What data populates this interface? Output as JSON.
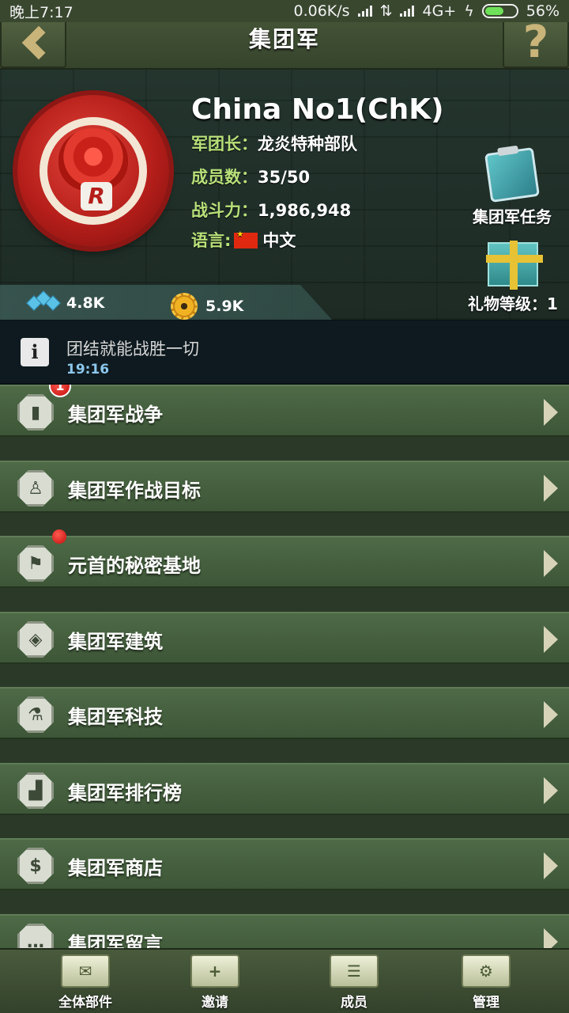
{
  "status_bar": {
    "time": "晚上7:17",
    "network_speed": "0.06K/s",
    "network_type": "4G+",
    "battery": "56%"
  },
  "title_bar": {
    "title": "集团军",
    "help_glyph": "?"
  },
  "legion": {
    "name": "China  No1(ChK)",
    "emblem_letter": "R",
    "leader_label": "军团长：",
    "leader_value": "龙炎特种部队",
    "members_label": "成员数：",
    "members_value": "35/50",
    "power_label": "战斗力：",
    "power_value": "1,986,948",
    "language_label": "语言:",
    "language_value": "中文"
  },
  "side_buttons": {
    "task_label": "集团军任务",
    "gift_label": "礼物等级：1"
  },
  "resources": {
    "blue_value": "4.8K",
    "gear_value": "5.9K"
  },
  "notice": {
    "icon_glyph": "i",
    "text": "团结就能战胜一切",
    "time": "19:16"
  },
  "menu": {
    "items": [
      {
        "label": "集团军战争",
        "badge": "1"
      },
      {
        "label": "集团军作战目标"
      },
      {
        "label": "元首的秘密基地"
      },
      {
        "label": "集团军建筑"
      },
      {
        "label": "集团军科技"
      },
      {
        "label": "集团军排行榜"
      },
      {
        "label": "集团军商店"
      },
      {
        "label": "集团军留言"
      }
    ]
  },
  "tabs": {
    "all_mail": "全体部件",
    "invite": "邀请",
    "members": "成员",
    "manage": "管理"
  },
  "colors": {
    "accent_green": "#b8e07a",
    "menu_green": "#4e6a47",
    "badge_red": "#c30d0d"
  }
}
